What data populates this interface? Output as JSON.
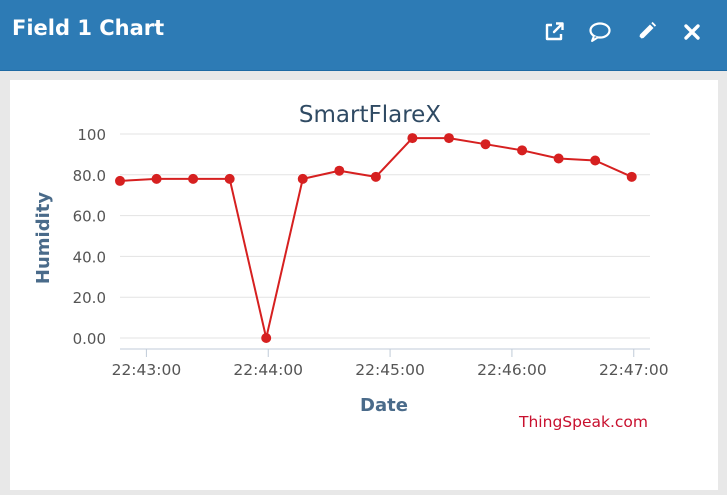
{
  "header": {
    "title": "Field 1 Chart",
    "actions": [
      {
        "name": "open-external-button",
        "icon": "external-link-icon"
      },
      {
        "name": "comment-button",
        "icon": "speech-bubble-icon"
      },
      {
        "name": "edit-button",
        "icon": "pencil-icon"
      },
      {
        "name": "close-button",
        "icon": "close-icon"
      }
    ]
  },
  "colors": {
    "header_bg": "#2d7bb5",
    "series": "#d62020",
    "title": "#2f4a63",
    "axis_label": "#4a6b8a",
    "credit": "#c8102e"
  },
  "chart_data": {
    "type": "line",
    "title": "SmartFlareX",
    "xlabel": "Date",
    "ylabel": "Humidity",
    "ylim": [
      0,
      100
    ],
    "yticks": [
      "0.00",
      "20.0",
      "40.0",
      "60.0",
      "80.0",
      "100"
    ],
    "xlim": [
      "22:42:47",
      "22:47:08"
    ],
    "xticks": [
      "22:43:00",
      "22:44:00",
      "22:45:00",
      "22:46:00",
      "22:47:00"
    ],
    "grid": true,
    "credit": "ThingSpeak.com",
    "series": [
      {
        "x": [
          "22:42:47",
          "22:43:05",
          "22:43:23",
          "22:43:41",
          "22:43:59",
          "22:44:17",
          "22:44:35",
          "22:44:53",
          "22:45:11",
          "22:45:29",
          "22:45:47",
          "22:46:05",
          "22:46:23",
          "22:46:41",
          "22:46:59"
        ],
        "values": [
          77,
          78,
          78,
          78,
          0,
          78,
          82,
          79,
          98,
          98,
          95,
          92,
          88,
          87,
          79
        ]
      }
    ]
  }
}
